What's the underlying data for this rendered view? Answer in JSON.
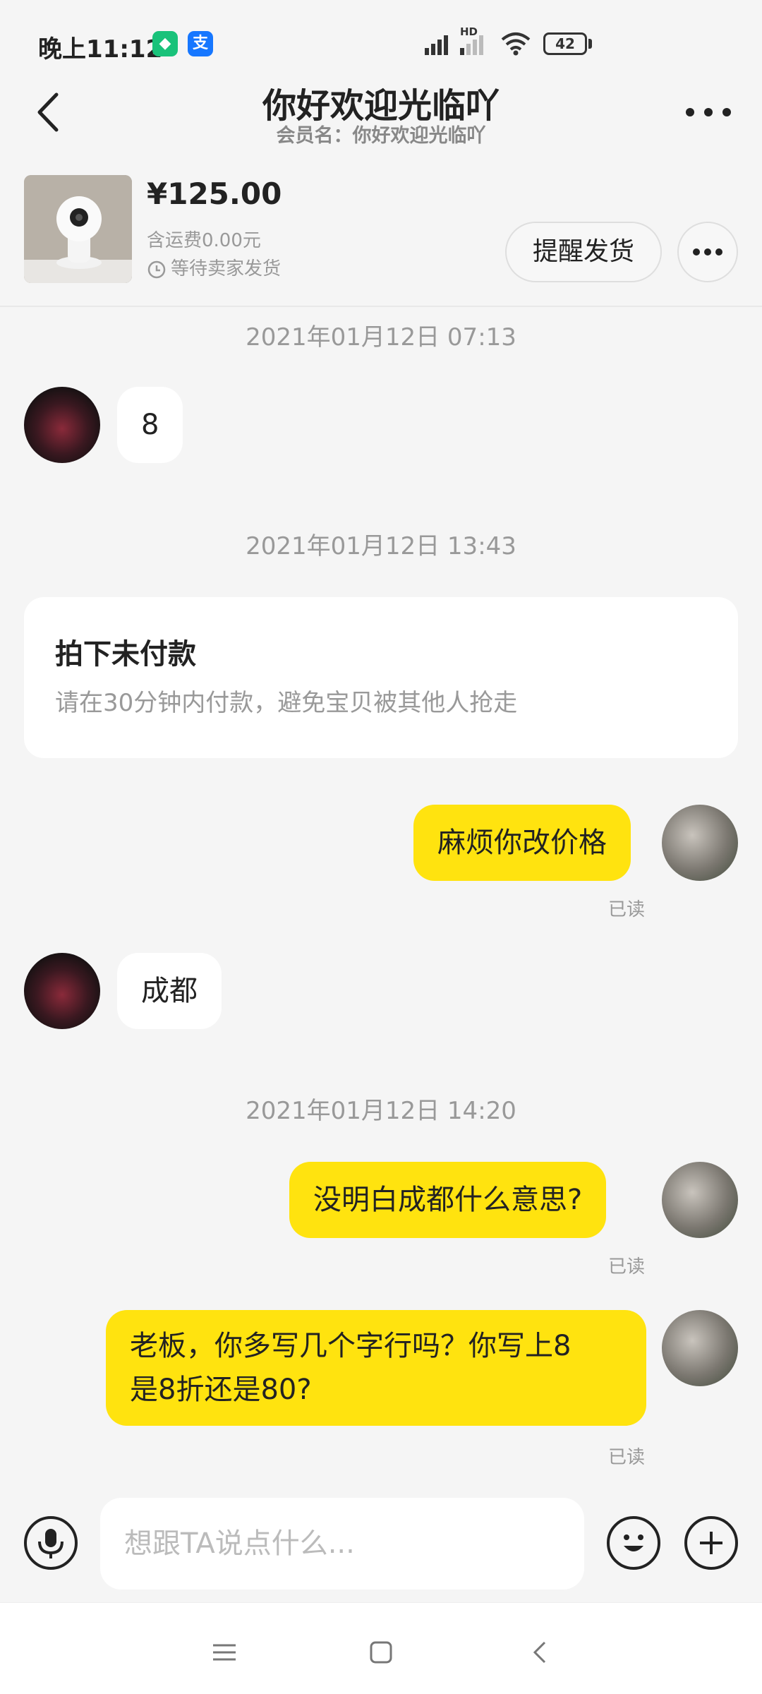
{
  "status_bar": {
    "time": "晚上11:12",
    "battery": "42",
    "hd_label": "HD",
    "app_badges": [
      "shield-app-icon",
      "alipay-icon"
    ]
  },
  "header": {
    "title": "你好欢迎光临吖",
    "subtitle": "会员名：你好欢迎光临吖"
  },
  "order": {
    "price": "¥125.00",
    "shipping": "含运费0.00元",
    "status": "等待卖家发货",
    "remind_label": "提醒发货"
  },
  "messages": {
    "ts1": "2021年01月12日 07:13",
    "m1": "8",
    "ts2": "2021年01月12日 13:43",
    "notice_title": "拍下未付款",
    "notice_text": "请在30分钟内付款，避免宝贝被其他人抢走",
    "m2": "麻烦你改价格",
    "read1": "已读",
    "m3": "成都",
    "ts3": "2021年01月12日 14:20",
    "m4": "没明白成都什么意思?",
    "read2": "已读",
    "m5_line1": "老板，你多写几个字行吗？你写上8",
    "m5_line2": "是8折还是80?",
    "read3": "已读"
  },
  "input": {
    "placeholder": "想跟TA说点什么..."
  },
  "colors": {
    "accent_yellow": "#ffe30f",
    "background": "#f5f5f5"
  }
}
